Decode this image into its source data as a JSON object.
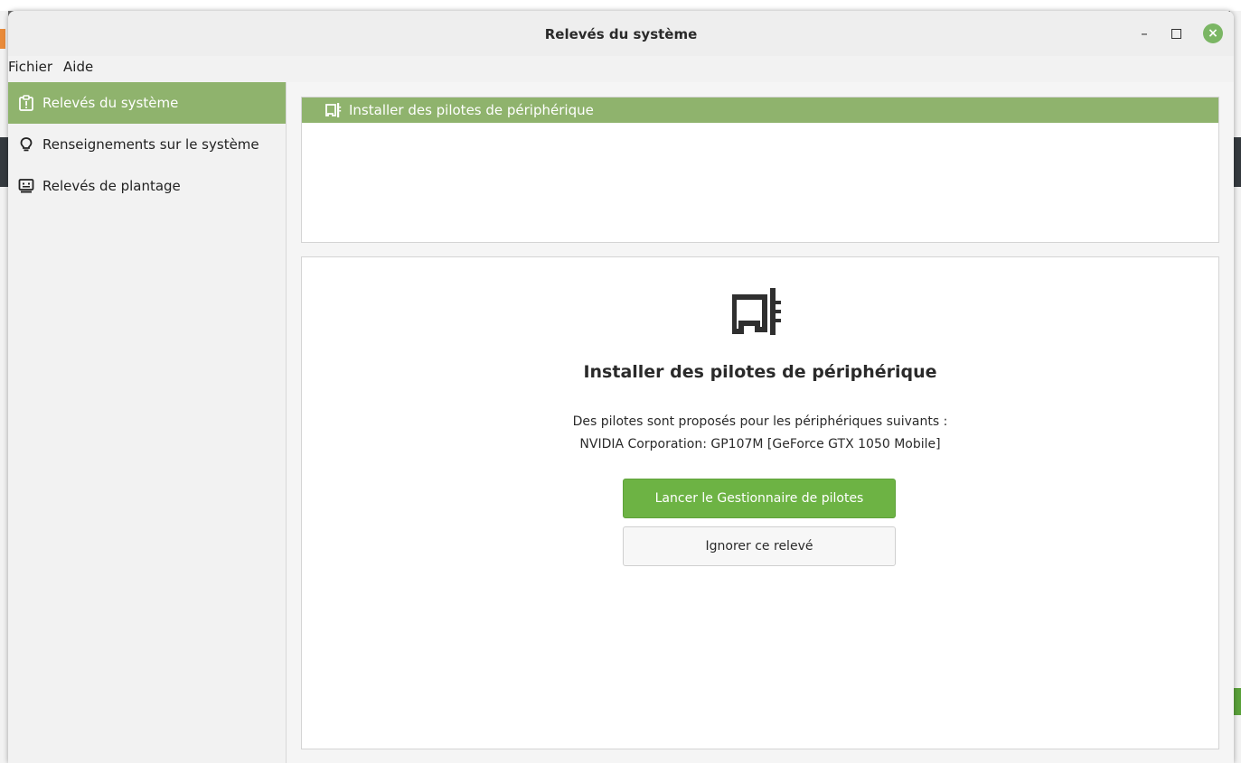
{
  "window": {
    "title": "Relevés du système"
  },
  "menubar": {
    "items": [
      "Fichier",
      "Aide"
    ]
  },
  "sidebar": {
    "items": [
      {
        "label": "Relevés du système",
        "icon": "report-icon",
        "active": true
      },
      {
        "label": "Renseignements sur le système",
        "icon": "lightbulb-icon",
        "active": false
      },
      {
        "label": "Relevés de plantage",
        "icon": "monitor-icon",
        "active": false
      }
    ]
  },
  "reports": {
    "list": [
      {
        "label": "Installer des pilotes de périphérique",
        "icon": "expansion-card-icon"
      }
    ]
  },
  "detail": {
    "icon": "expansion-card-icon",
    "title": "Installer des pilotes de périphérique",
    "description_line1": "Des pilotes sont proposés pour les périphériques suivants :",
    "description_line2": "NVIDIA Corporation: GP107M [GeForce GTX 1050 Mobile]",
    "primary_button": "Lancer le Gestionnaire de pilotes",
    "secondary_button": "Ignorer ce relevé"
  },
  "colors": {
    "accent": "#8fb36d",
    "button_primary": "#6db344",
    "close_button": "#7bb664"
  }
}
